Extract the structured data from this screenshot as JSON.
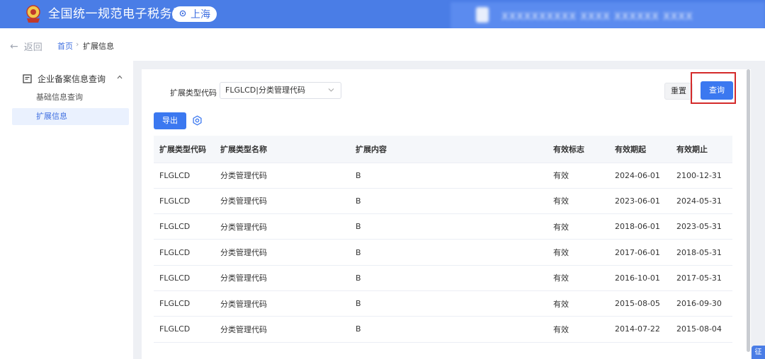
{
  "header": {
    "title": "全国统一规范电子税务局",
    "region": "上海",
    "user_info_blurred": "XXXXXXXXXX XXXX XXXXXX XXXX",
    "brand_color": "#4a7de6"
  },
  "breadcrumb": {
    "back": "返回",
    "home": "首页",
    "separator": "›",
    "current": "扩展信息"
  },
  "sidebar": {
    "group_label": "企业备案信息查询",
    "items": [
      {
        "label": "基础信息查询",
        "active": false
      },
      {
        "label": "扩展信息",
        "active": true
      }
    ]
  },
  "filter": {
    "label": "扩展类型代码",
    "select_value": "FLGLCD|分类管理代码",
    "reset_label": "重置",
    "query_label": "查询"
  },
  "toolbar": {
    "export_label": "导出"
  },
  "table": {
    "columns": [
      "扩展类型代码",
      "扩展类型名称",
      "扩展内容",
      "有效标志",
      "有效期起",
      "有效期止"
    ],
    "rows": [
      [
        "FLGLCD",
        "分类管理代码",
        "B",
        "有效",
        "2024-06-01",
        "2100-12-31"
      ],
      [
        "FLGLCD",
        "分类管理代码",
        "B",
        "有效",
        "2023-06-01",
        "2024-05-31"
      ],
      [
        "FLGLCD",
        "分类管理代码",
        "B",
        "有效",
        "2018-06-01",
        "2023-05-31"
      ],
      [
        "FLGLCD",
        "分类管理代码",
        "B",
        "有效",
        "2017-06-01",
        "2018-05-31"
      ],
      [
        "FLGLCD",
        "分类管理代码",
        "B",
        "有效",
        "2016-10-01",
        "2017-05-31"
      ],
      [
        "FLGLCD",
        "分类管理代码",
        "B",
        "有效",
        "2015-08-05",
        "2016-09-30"
      ],
      [
        "FLGLCD",
        "分类管理代码",
        "B",
        "有效",
        "2014-07-22",
        "2015-08-04"
      ]
    ]
  },
  "float_button": "征",
  "colors": {
    "primary": "#3b78f0",
    "highlight_outline": "#d42a2a"
  }
}
